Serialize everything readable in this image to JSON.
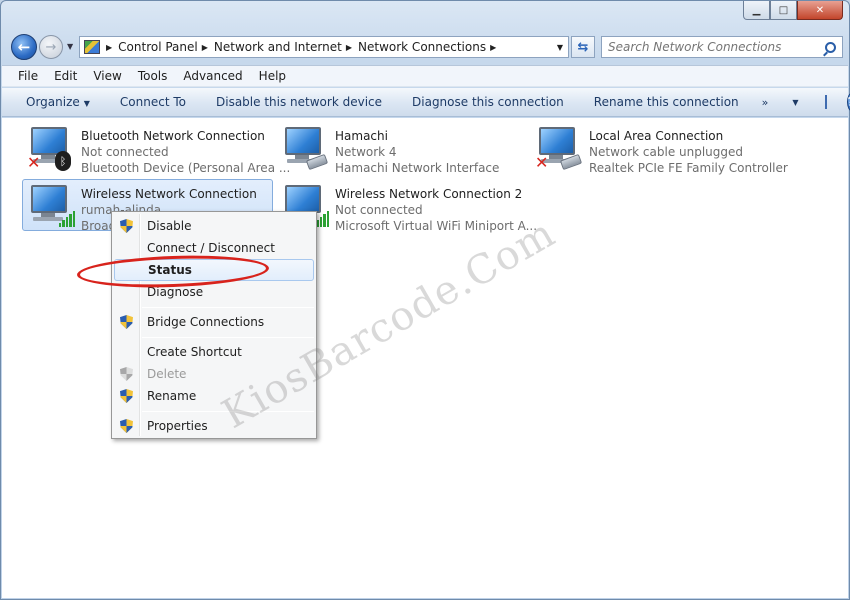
{
  "window": {
    "caption_buttons": {
      "minimize": "▁",
      "maximize": "□",
      "close": "✕"
    }
  },
  "address": {
    "crumbs": [
      "Control Panel",
      "Network and Internet",
      "Network Connections"
    ],
    "search_placeholder": "Search Network Connections"
  },
  "menubar": {
    "items": [
      "File",
      "Edit",
      "View",
      "Tools",
      "Advanced",
      "Help"
    ]
  },
  "commandbar": {
    "organize": "Organize",
    "connect_to": "Connect To",
    "disable": "Disable this network device",
    "diagnose": "Diagnose this connection",
    "rename": "Rename this connection",
    "more": "»"
  },
  "connections": [
    {
      "title": "Bluetooth Network Connection",
      "status": "Not connected",
      "device": "Bluetooth Device (Personal Area ...",
      "icon": "bluetooth-icon",
      "state": "disconnected"
    },
    {
      "title": "Hamachi",
      "status": "Network  4",
      "device": "Hamachi Network Interface",
      "icon": "network-cable-icon",
      "state": "connected"
    },
    {
      "title": "Local Area Connection",
      "status": "Network cable unplugged",
      "device": "Realtek PCIe FE Family Controller",
      "icon": "network-cable-icon",
      "state": "disconnected"
    },
    {
      "title": "Wireless Network Connection",
      "status": "rumah-alinda",
      "device": "Broad",
      "icon": "wifi-signal-icon",
      "state": "connected",
      "selected": true
    },
    {
      "title": "Wireless Network Connection 2",
      "status": "Not connected",
      "device": "Microsoft Virtual WiFi Miniport A...",
      "icon": "wifi-signal-icon",
      "state": "disconnected"
    }
  ],
  "context_menu": {
    "items": [
      "Disable",
      "Connect / Disconnect",
      "Status",
      "Diagnose",
      "Bridge Connections",
      "Create Shortcut",
      "Delete",
      "Rename",
      "Properties"
    ],
    "highlighted": "Status",
    "disabled": [
      "Delete"
    ]
  },
  "watermark": "KiosBarcode.Com",
  "colors": {
    "accent": "#3e6bb0",
    "highlight_ellipse": "#d8231c"
  }
}
